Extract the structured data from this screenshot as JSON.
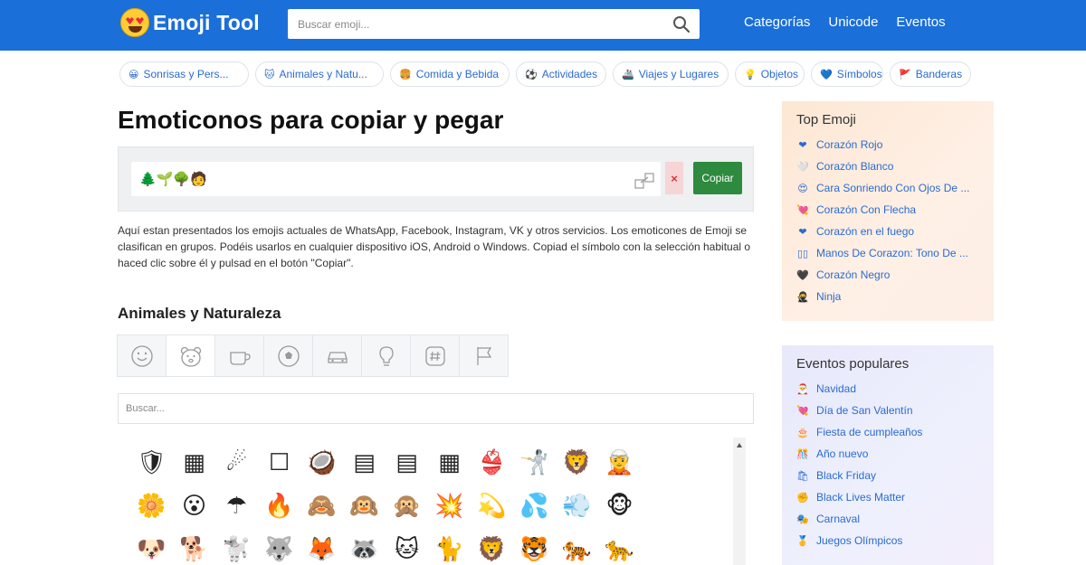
{
  "header": {
    "logo_text": "Emoji Tool",
    "search_placeholder": "Buscar emoji...",
    "nav": [
      "Categorías",
      "Unicode",
      "Eventos"
    ]
  },
  "chips": [
    {
      "icon": "😀",
      "label": "Sonrisas y Pers..."
    },
    {
      "icon": "🐱",
      "label": "Animales y Natu..."
    },
    {
      "icon": "🍔",
      "label": "Comida y Bebida"
    },
    {
      "icon": "⚽",
      "label": "Actividades"
    },
    {
      "icon": "🚢",
      "label": "Viajes y Lugares"
    },
    {
      "icon": "💡",
      "label": "Objetos"
    },
    {
      "icon": "💙",
      "label": "Símbolos"
    },
    {
      "icon": "🚩",
      "label": "Banderas"
    }
  ],
  "main": {
    "title": "Emoticonos para copiar y pegar",
    "copy_emojis": "🌲🌱🌳🧑",
    "clear_label": "×",
    "copy_label": "Copiar",
    "description": "Aquí estan presentados los emojis actuales de WhatsApp, Facebook, Instagram, VK y otros servicios. Los emoticones de Emoji se clasifican en grupos. Podéis usarlos en cualquier dispositivo iOS, Android o Windows. Copiad el símbolo con la selección habitual o haced clic sobre él y pulsad en el botón \"Copiar\".",
    "section_title": "Animales y Naturaleza",
    "grid_search_placeholder": "Buscar...",
    "emoji_rows": [
      [
        "🛡",
        "▦",
        "☄",
        "☐",
        "🥥",
        "▤",
        "▤",
        "▦",
        "👙",
        "🤺",
        "🦁",
        "🧝"
      ],
      [
        "🌼",
        "😮",
        "☂",
        "🔥",
        "🙈",
        "🙉",
        "🙊",
        "💥",
        "💫",
        "💦",
        "💨",
        "🐵"
      ],
      [
        "🐶",
        "🐕",
        "🐩",
        "🐺",
        "🦊",
        "🦝",
        "🐱",
        "🐈",
        "🦁",
        "🐯",
        "🐅",
        "🐆"
      ]
    ]
  },
  "extra_grid_col": [
    "🩳",
    "🐒",
    "🐴"
  ],
  "extra_grid_col2": [
    "🦥",
    "🦍",
    "🐎"
  ],
  "sidebar": {
    "top": {
      "title": "Top Emoji",
      "items": [
        {
          "icon": "❤",
          "label": "Corazón Rojo"
        },
        {
          "icon": "🤍",
          "label": "Corazón Blanco"
        },
        {
          "icon": "😍",
          "label": "Cara Sonriendo Con Ojos De ..."
        },
        {
          "icon": "💘",
          "label": "Corazón Con Flecha"
        },
        {
          "icon": "❤",
          "label": "Corazón en el fuego"
        },
        {
          "icon": "▯▯",
          "label": "Manos De Corazon: Tono De ..."
        },
        {
          "icon": "🖤",
          "label": "Corazón Negro"
        },
        {
          "icon": "🥷",
          "label": "Ninja"
        }
      ]
    },
    "events": {
      "title": "Eventos populares",
      "items": [
        {
          "icon": "🎅",
          "label": "Navidad"
        },
        {
          "icon": "💘",
          "label": "Día de San Valentín"
        },
        {
          "icon": "🎂",
          "label": "Fiesta de cumpleaños"
        },
        {
          "icon": "🎊",
          "label": "Año nuevo"
        },
        {
          "icon": "🛍",
          "label": "Black Friday"
        },
        {
          "icon": "✊",
          "label": "Black Lives Matter"
        },
        {
          "icon": "🎭",
          "label": "Carnaval"
        },
        {
          "icon": "🥇",
          "label": "Juegos Olímpicos"
        }
      ]
    }
  }
}
